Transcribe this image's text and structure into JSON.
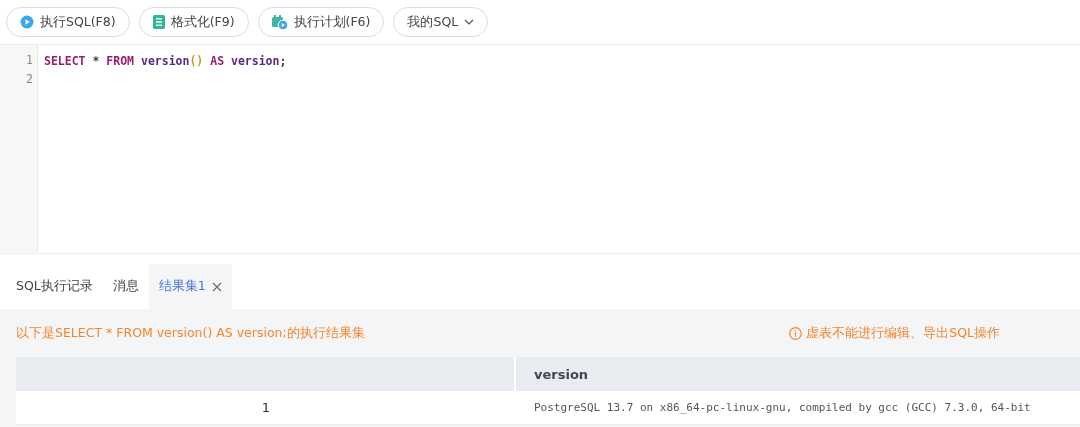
{
  "toolbar": [
    {
      "label": "执行SQL(F8)",
      "kind": "run"
    },
    {
      "label": "格式化(F9)",
      "kind": "format"
    },
    {
      "label": "执行计划(F6)",
      "kind": "plan"
    },
    {
      "label": "我的SQL",
      "kind": "dropdown"
    }
  ],
  "editor": {
    "lines": [
      {
        "number": "1",
        "tokens": [
          {
            "text": "SELECT",
            "kind": "keyword"
          },
          {
            "text": " * ",
            "kind": "plain"
          },
          {
            "text": "FROM",
            "kind": "keyword"
          },
          {
            "text": " version",
            "kind": "ident"
          },
          {
            "text": "()",
            "kind": "paren"
          },
          {
            "text": " AS",
            "kind": "keyword"
          },
          {
            "text": " version",
            "kind": "ident"
          },
          {
            "text": ";",
            "kind": "plain"
          }
        ]
      },
      {
        "number": "2"
      }
    ]
  },
  "result_tabs": [
    {
      "label": "SQL执行记录",
      "selected": false,
      "closable": false
    },
    {
      "label": "消息",
      "selected": false,
      "closable": false
    },
    {
      "label": "结果集1",
      "selected": true,
      "closable": true
    }
  ],
  "result": {
    "message": "以下是SELECT * FROM version() AS version;的执行结果集",
    "notice": "虚表不能进行编辑、导出SQL操作",
    "table": {
      "columns": [
        "version"
      ],
      "rows": [
        {
          "index": "1",
          "cells": [
            "PostgreSQL 13.7 on x86_64-pc-linux-gnu, compiled by gcc (GCC) 7.3.0, 64-bit"
          ]
        }
      ]
    }
  }
}
